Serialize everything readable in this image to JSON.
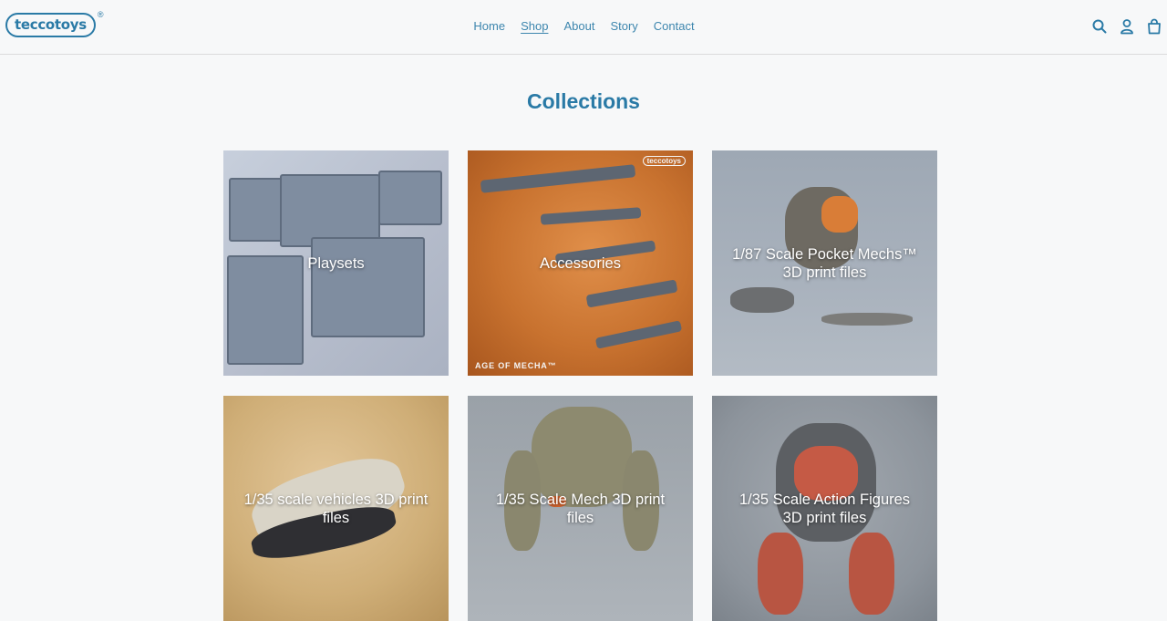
{
  "header": {
    "logo_text": "teccotoys",
    "logo_mark": "®",
    "nav": [
      {
        "label": "Home"
      },
      {
        "label": "Shop",
        "active": true
      },
      {
        "label": "About"
      },
      {
        "label": "Story"
      },
      {
        "label": "Contact"
      }
    ],
    "icons": [
      "search-icon",
      "account-icon",
      "cart-icon"
    ]
  },
  "page_title": "Collections",
  "collections": [
    {
      "label": "Playsets"
    },
    {
      "label": "Accessories",
      "image_text_logo": "teccotoys",
      "image_text_banner": "AGE OF MECHA™"
    },
    {
      "label": "1/87 Scale Pocket Mechs™ 3D print files"
    },
    {
      "label": "1/35 scale vehicles 3D print files"
    },
    {
      "label": "1/35 Scale Mech 3D print files"
    },
    {
      "label": "1/35 Scale Action Figures 3D print files"
    }
  ],
  "colors": {
    "brand": "#2a7aa6",
    "background": "#f7f8f9"
  }
}
